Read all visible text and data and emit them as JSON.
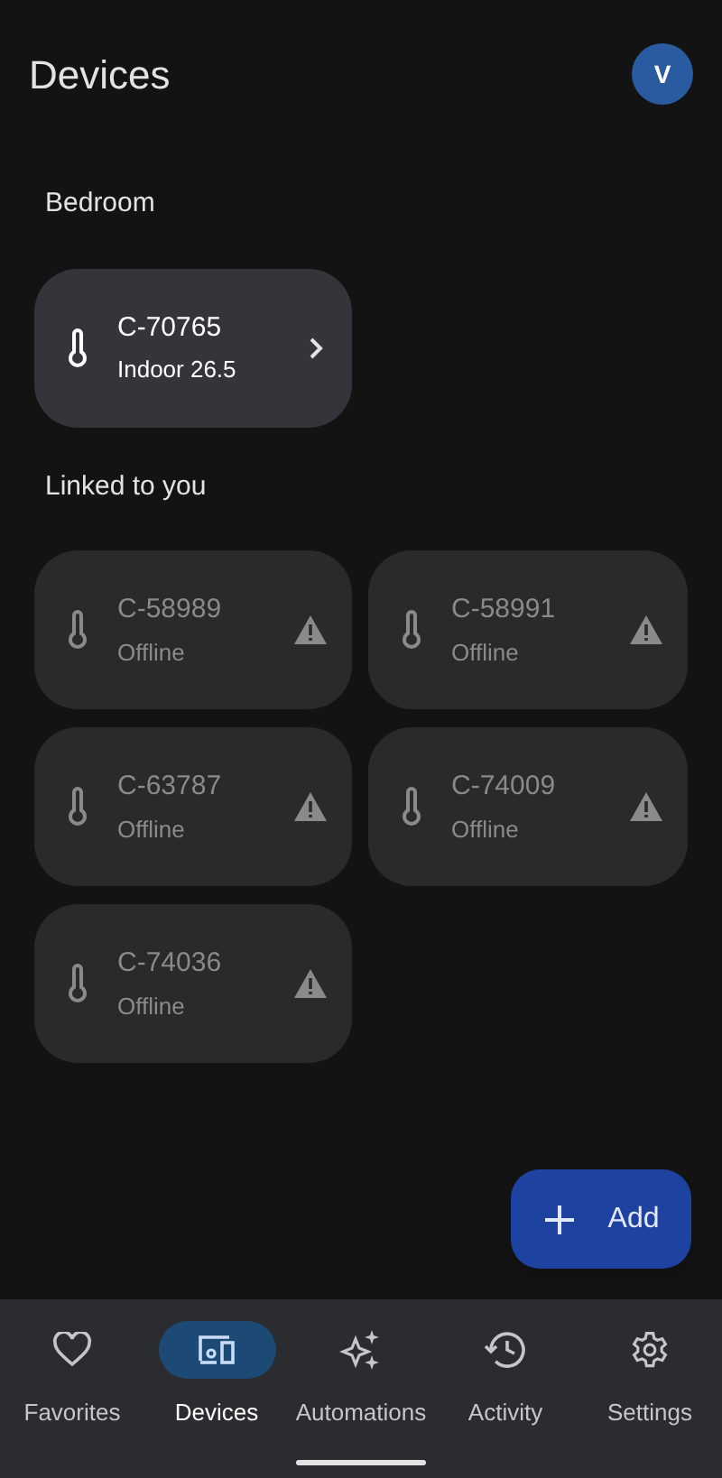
{
  "header": {
    "title": "Devices",
    "avatar": "V"
  },
  "sections": [
    {
      "title": "Bedroom",
      "devices": [
        {
          "name": "C-70765",
          "status": "Indoor 26.5",
          "online": true
        }
      ]
    },
    {
      "title": "Linked to you",
      "devices": [
        {
          "name": "C-58989",
          "status": "Offline",
          "online": false
        },
        {
          "name": "C-58991",
          "status": "Offline",
          "online": false
        },
        {
          "name": "C-63787",
          "status": "Offline",
          "online": false
        },
        {
          "name": "C-74009",
          "status": "Offline",
          "online": false
        },
        {
          "name": "C-74036",
          "status": "Offline",
          "online": false
        }
      ]
    }
  ],
  "fab": {
    "label": "Add"
  },
  "nav": [
    {
      "label": "Favorites",
      "kind": "favorites",
      "selected": false
    },
    {
      "label": "Devices",
      "kind": "devices",
      "selected": true
    },
    {
      "label": "Automations",
      "kind": "automations",
      "selected": false
    },
    {
      "label": "Activity",
      "kind": "activity",
      "selected": false
    },
    {
      "label": "Settings",
      "kind": "settings",
      "selected": false
    }
  ]
}
